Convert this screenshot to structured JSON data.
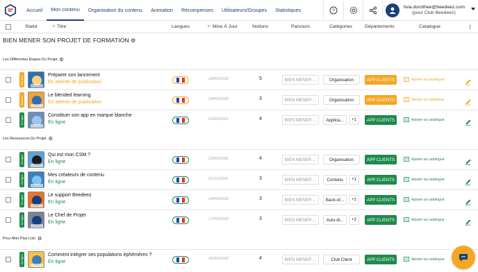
{
  "nav": {
    "items": [
      {
        "label": "Accueil",
        "active": false
      },
      {
        "label": "Mon contenu",
        "active": true
      },
      {
        "label": "Organisation du contenu",
        "active": false
      },
      {
        "label": "Animation",
        "active": false
      },
      {
        "label": "Récompenses",
        "active": false
      },
      {
        "label": "Utilisateurs/Groupes",
        "active": false
      },
      {
        "label": "Statistiques",
        "active": false
      }
    ],
    "icons": [
      "help-icon",
      "settings-icon",
      "share-network-icon"
    ]
  },
  "user": {
    "email": "livia.dorothee@beedeez.com",
    "org": "(pour Club Beedeez)"
  },
  "table_headers": {
    "statut": "Statut",
    "titre": "Titre",
    "langues": "Langues",
    "mise_a_jour": "Mise À Jour",
    "notions": "Notions",
    "parcours": "Parcours",
    "categories": "Catégories",
    "departements": "Départements",
    "catalogue": "Catalogue"
  },
  "page_title": "BIEN MENER SON PROJET DE FORMATION",
  "sections": [
    {
      "label": "Les Différentes Étapes Du Projet"
    },
    {
      "label": "Les Ressources Du Projet"
    },
    {
      "label": "Pour Aller Plus Loin"
    }
  ],
  "colors": {
    "brand": "#1a3f7a",
    "online": "#1e8a4c",
    "pending": "#f5a623",
    "dept": "#f5a623",
    "dept_green": "#1e8a4c"
  },
  "rows": [
    {
      "title": "Préparer son lancement",
      "status": "En attente de publication",
      "status_kind": "pending",
      "badge": "Brouillon",
      "date": "28/03/2022",
      "notions": "5",
      "parcours": "BIEN MENER ...",
      "category": "Organisation",
      "plus": "",
      "dept": "APP CLIENTS",
      "catalog": "Ajouter au catalogue"
    },
    {
      "title": "Le blended learning",
      "status": "En attente de publication",
      "status_kind": "pending",
      "badge": "Brouillon",
      "date": "24/06/2022",
      "notions": "3",
      "parcours": "BIEN MENER ...",
      "category": "Organisation",
      "plus": "",
      "dept": "APP CLIENTS",
      "catalog": "Ajouter au catalogue"
    },
    {
      "title": "Constituer son app en marque blanche",
      "status": "En ligne",
      "status_kind": "online",
      "badge": "En ligne",
      "date": "02/06/2021",
      "notions": "4",
      "parcours": "BIEN MENER ...",
      "category": "Applica...",
      "plus": "+1",
      "dept": "APP CLIENTS",
      "catalog": "Ajouter au catalogue"
    },
    {
      "title": "Qui est mon CSM ?",
      "status": "En ligne",
      "status_kind": "online",
      "badge": "En ligne",
      "date": "23/02/2022",
      "notions": "4",
      "parcours": "BIEN MENER ...",
      "category": "Organisation",
      "plus": "",
      "dept": "APP CLIENTS",
      "catalog": "Ajouter au catalogue"
    },
    {
      "title": "Mes créateurs de contenu",
      "status": "En ligne",
      "status_kind": "online",
      "badge": "En ligne",
      "date": "01/12/2021",
      "notions": "3",
      "parcours": "BIEN MENER ...",
      "category": "Contenu",
      "plus": "+1",
      "dept": "APP CLIENTS",
      "catalog": "Ajouter au catalogue"
    },
    {
      "title": "Le support Beedeez",
      "status": "En ligne",
      "status_kind": "online",
      "badge": "En ligne",
      "date": "24/06/2022",
      "notions": "3",
      "parcours": "BIEN MENER ...",
      "category": "Back-of...",
      "plus": "+1",
      "dept": "APP CLIENTS",
      "catalog": "Ajouter au catalogue"
    },
    {
      "title": "Le Chef de Projet",
      "status": "En ligne",
      "status_kind": "online",
      "badge": "En ligne",
      "date": "17/03/2022",
      "notions": "3",
      "parcours": "BIEN MENER ...",
      "category": "Auto-di...",
      "plus": "+2",
      "dept": "APP CLIENTS",
      "catalog": "Ajouter au catalogue"
    },
    {
      "title": "Comment intégrer ses populations éphémères ?",
      "status": "En ligne",
      "status_kind": "online",
      "badge": "En ligne",
      "date": "05/05/2022",
      "notions": "4",
      "parcours": "BIEN MENER ...",
      "category": "Club Client",
      "plus": "",
      "dept": "APP CLIENTS",
      "catalog": "Ajouter au catalogue"
    }
  ]
}
